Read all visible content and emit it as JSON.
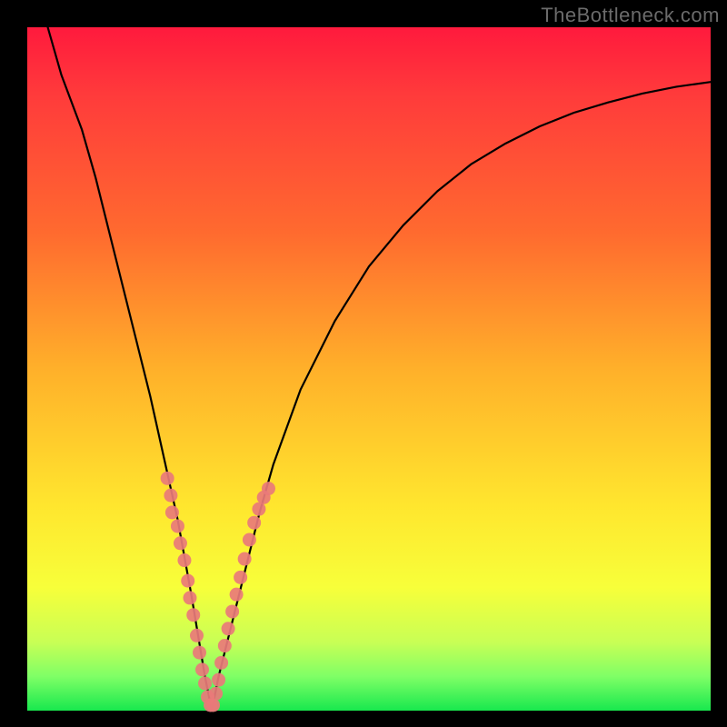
{
  "watermark": "TheBottleneck.com",
  "chart_data": {
    "type": "line",
    "title": "",
    "xlabel": "",
    "ylabel": "",
    "xlim": [
      0,
      100
    ],
    "ylim": [
      0,
      100
    ],
    "curve_minimum_x": 27,
    "curve": {
      "x": [
        3,
        5,
        8,
        10,
        12,
        14,
        16,
        18,
        20,
        22,
        24,
        25,
        26,
        27,
        28,
        30,
        32,
        34,
        36,
        40,
        45,
        50,
        55,
        60,
        65,
        70,
        75,
        80,
        85,
        90,
        95,
        100
      ],
      "y": [
        100,
        93,
        85,
        78,
        70,
        62,
        54,
        46,
        37,
        28,
        17,
        11,
        5,
        0,
        5,
        13,
        21,
        29,
        36,
        47,
        57,
        65,
        71,
        76,
        80,
        83,
        85.5,
        87.5,
        89,
        90.3,
        91.3,
        92
      ]
    },
    "series": [
      {
        "name": "left-cluster",
        "x": [
          20.5,
          21.0,
          21.2,
          22.0,
          22.4,
          23.0,
          23.5,
          23.8,
          24.3,
          24.8,
          25.2,
          25.6,
          26.0,
          26.4,
          26.8
        ],
        "y": [
          34.0,
          31.5,
          29.0,
          27.0,
          24.5,
          22.0,
          19.0,
          16.5,
          14.0,
          11.0,
          8.5,
          6.0,
          4.0,
          2.0,
          0.8
        ]
      },
      {
        "name": "right-cluster",
        "x": [
          27.2,
          27.6,
          28.0,
          28.4,
          28.9,
          29.4,
          30.0,
          30.6,
          31.2,
          31.8,
          32.5,
          33.2,
          33.9,
          34.6,
          35.3
        ],
        "y": [
          0.8,
          2.5,
          4.5,
          7.0,
          9.5,
          12.0,
          14.5,
          17.0,
          19.5,
          22.2,
          25.0,
          27.5,
          29.5,
          31.2,
          32.5
        ]
      }
    ]
  }
}
